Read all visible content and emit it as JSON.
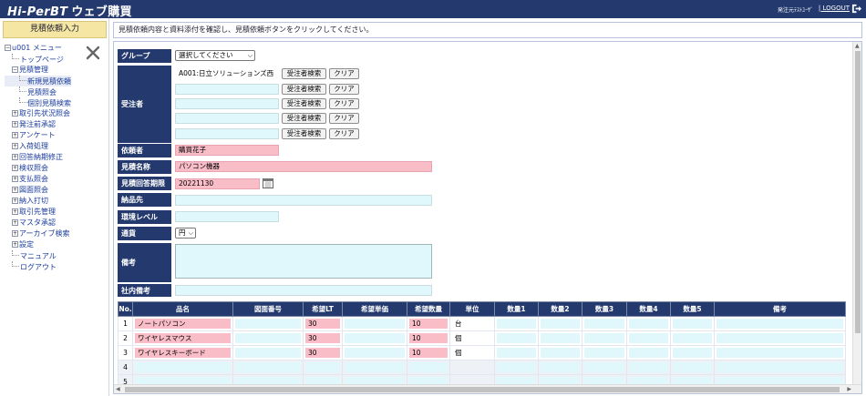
{
  "header": {
    "title_en": "Hi-PerBT",
    "title_ja": "ウェブ購買",
    "user": "発注元ﾃｽﾄﾕｰｻﾞ",
    "logout": "LOGOUT"
  },
  "sidebar": {
    "title": "見積依頼入力",
    "tree": [
      {
        "label": "u001 メニュー",
        "expander": "−",
        "depth": 0
      },
      {
        "label": "トップページ",
        "depth": 1
      },
      {
        "label": "見積管理",
        "expander": "−",
        "depth": 1
      },
      {
        "label": "新規見積依頼",
        "depth": 2,
        "selected": true
      },
      {
        "label": "見積照会",
        "depth": 2
      },
      {
        "label": "個別見積検索",
        "depth": 2
      },
      {
        "label": "取引先状況照会",
        "expander": "+",
        "depth": 1
      },
      {
        "label": "発注前承認",
        "expander": "+",
        "depth": 1
      },
      {
        "label": "アンケート",
        "expander": "+",
        "depth": 1
      },
      {
        "label": "入荷処理",
        "expander": "+",
        "depth": 1
      },
      {
        "label": "回答納期修正",
        "expander": "+",
        "depth": 1
      },
      {
        "label": "検収照会",
        "expander": "+",
        "depth": 1
      },
      {
        "label": "支払照会",
        "expander": "+",
        "depth": 1
      },
      {
        "label": "図面照会",
        "expander": "+",
        "depth": 1
      },
      {
        "label": "納入打切",
        "expander": "+",
        "depth": 1
      },
      {
        "label": "取引先管理",
        "expander": "+",
        "depth": 1
      },
      {
        "label": "マスタ承認",
        "expander": "+",
        "depth": 1
      },
      {
        "label": "アーカイブ検索",
        "expander": "+",
        "depth": 1
      },
      {
        "label": "設定",
        "expander": "+",
        "depth": 1
      },
      {
        "label": "マニュアル",
        "depth": 1
      },
      {
        "label": "ログアウト",
        "depth": 1
      }
    ]
  },
  "instruction": "見積依頼内容と資料添付を確認し、見積依頼ボタンをクリックしてください。",
  "form": {
    "group_label": "グループ",
    "group_value": "選択してください",
    "supplier_label": "受注者",
    "suppliers": [
      "A001:日立ソリューションズ西",
      "",
      "",
      "",
      ""
    ],
    "search_btn": "受注者検索",
    "clear_btn": "クリア",
    "requester_label": "依頼者",
    "requester_value": "購買花子",
    "estimate_name_label": "見積名称",
    "estimate_name_value": "パソコン機器",
    "due_label": "見積回答期限",
    "due_value": "20221130",
    "delivery_label": "納品先",
    "delivery_value": "",
    "env_label": "環境レベル",
    "env_value": "",
    "currency_label": "通貨",
    "currency_value": "円",
    "remarks_label": "備考",
    "internal_label": "社内備考",
    "internal_value": ""
  },
  "grid": {
    "headers": [
      "No.",
      "品名",
      "図面番号",
      "希望LT",
      "希望単価",
      "希望数量",
      "単位",
      "数量1",
      "数量2",
      "数量3",
      "数量4",
      "数量5",
      "備考"
    ],
    "rows": [
      {
        "no": "1",
        "name": "ノートパソコン",
        "lt": "30",
        "qty": "10",
        "unit": "台"
      },
      {
        "no": "2",
        "name": "ワイヤレスマウス",
        "lt": "30",
        "qty": "10",
        "unit": "個"
      },
      {
        "no": "3",
        "name": "ワイヤレスキーボード",
        "lt": "30",
        "qty": "10",
        "unit": "個"
      },
      {
        "no": "4",
        "name": "",
        "lt": "",
        "qty": "",
        "unit": ""
      },
      {
        "no": "5",
        "name": "",
        "lt": "",
        "qty": "",
        "unit": ""
      }
    ]
  }
}
